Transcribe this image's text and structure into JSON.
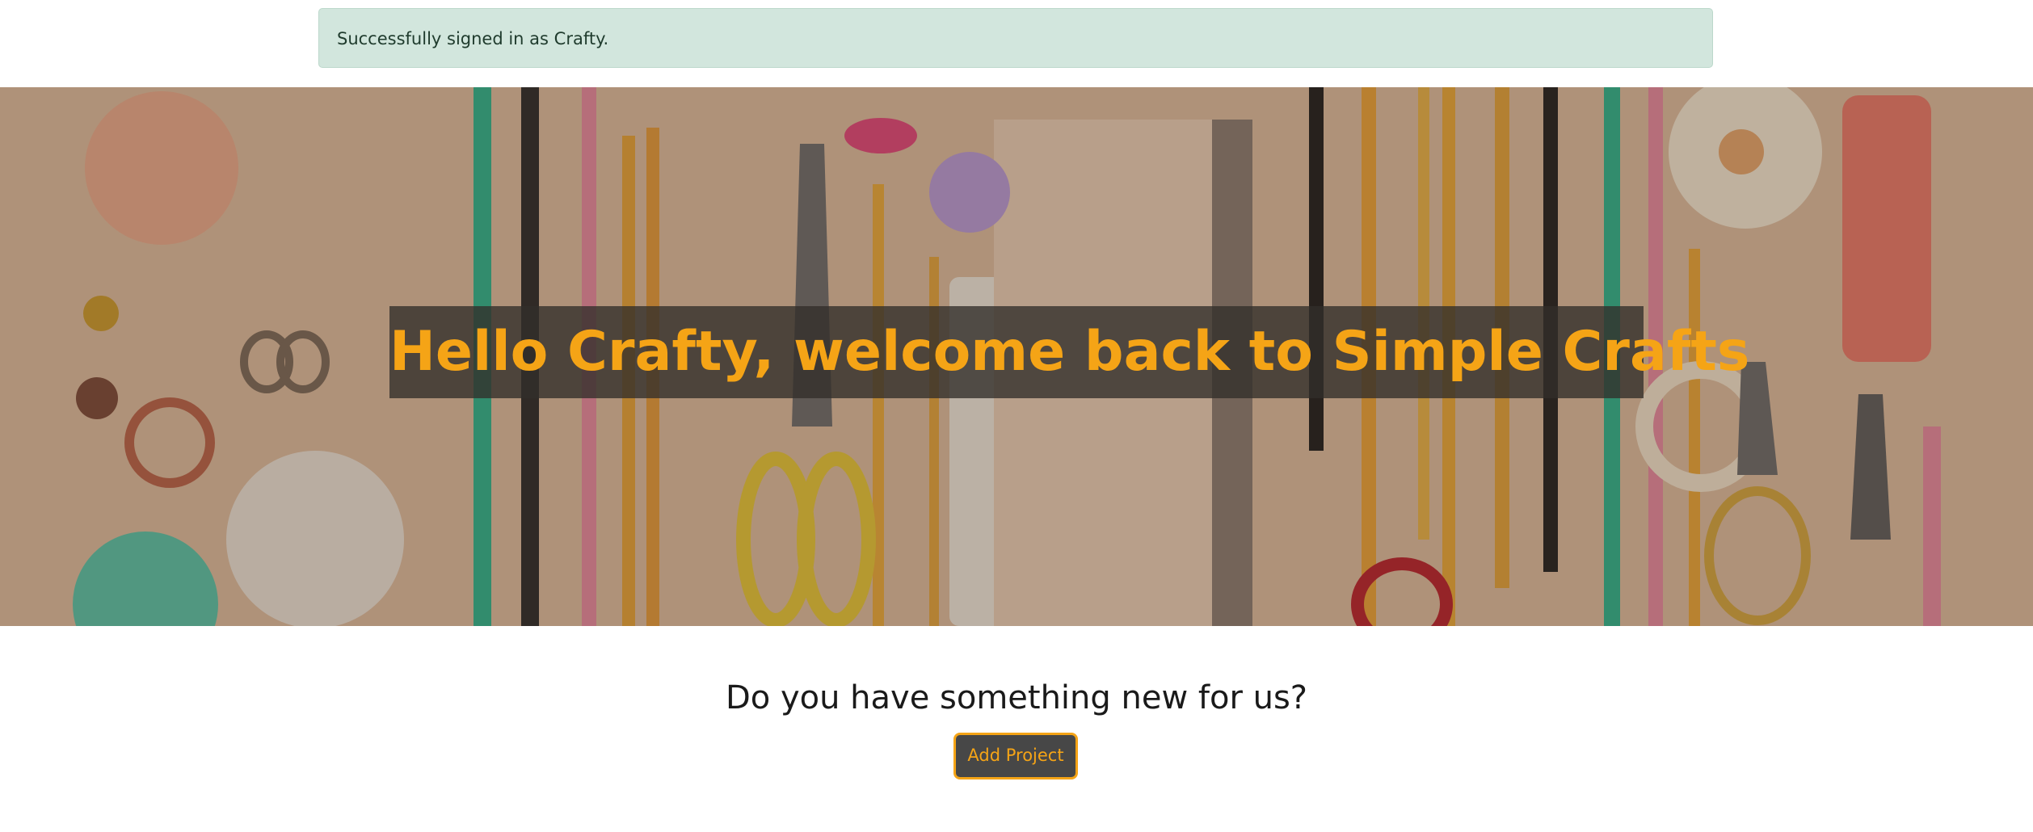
{
  "alert": {
    "message": "Successfully signed in as Crafty."
  },
  "hero": {
    "title": "Hello Crafty, welcome back to Simple Crafts",
    "image_description_icon": "craft-supplies-image"
  },
  "cta": {
    "heading": "Do you have something new for us?",
    "button_label": "Add Project"
  },
  "colors": {
    "accent": "#f5a416",
    "alert_bg": "#d2e6dd",
    "button_bg": "#474747"
  }
}
